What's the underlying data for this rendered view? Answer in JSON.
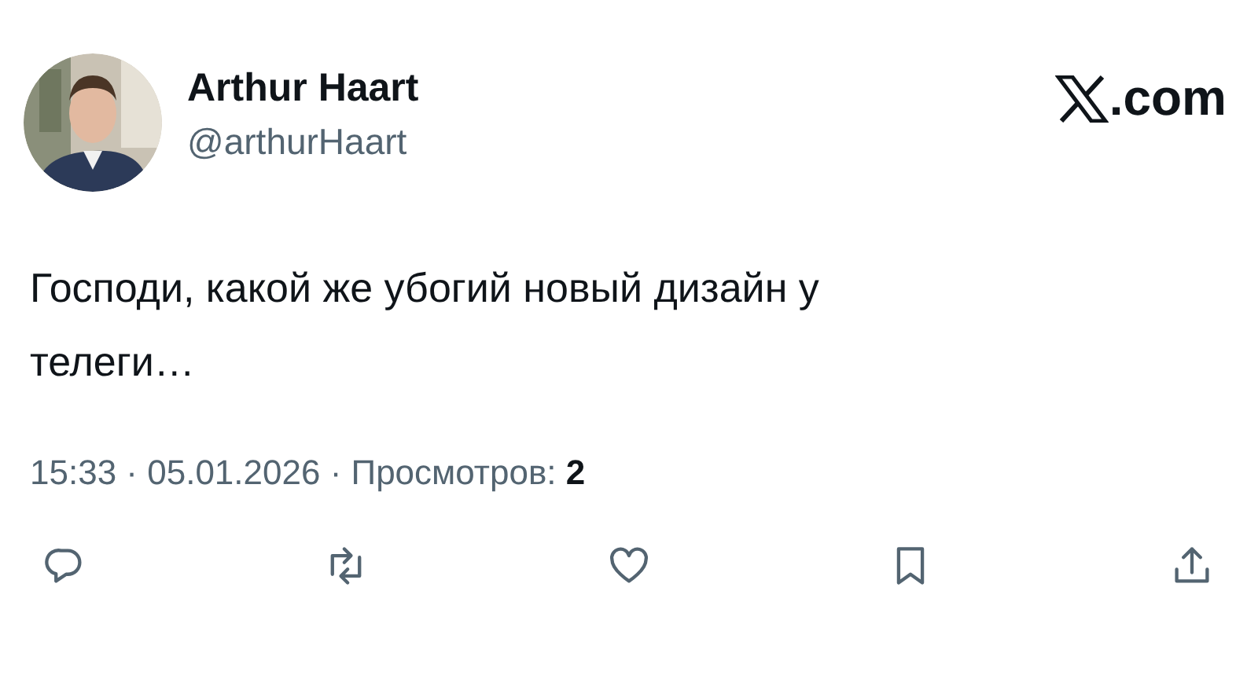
{
  "author": {
    "name": "Arthur Haart",
    "handle": "@arthurHaart"
  },
  "site": {
    "suffix": ".com"
  },
  "text": "Господи, какой же убогий новый дизайн у телеги…",
  "meta": "15:33 · 05.01.2026 · Просмотров: **2**",
  "actions": [
    {
      "kind": "reply"
    },
    {
      "kind": "repost"
    },
    {
      "kind": "like"
    },
    {
      "kind": "bookmark"
    },
    {
      "kind": "share"
    }
  ]
}
